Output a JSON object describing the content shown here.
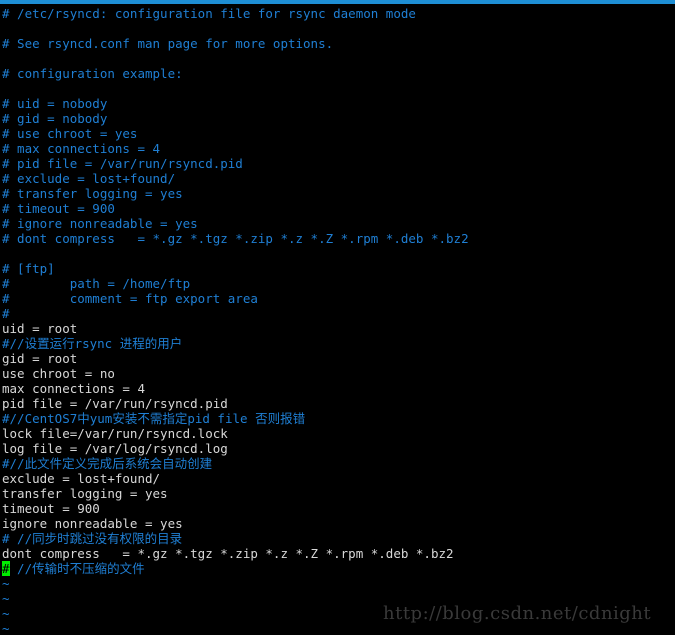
{
  "window": {
    "title": "vim /etc/rsyncd.conf",
    "top_bar_color": "#1e8fd5",
    "background_color": "#000000",
    "comment_color": "#1f7fd4",
    "text_color": "#d8d8d8",
    "cursor_color": "#00ee00"
  },
  "editor": {
    "lines": [
      {
        "id": 1,
        "kind": "comment",
        "text": "# /etc/rsyncd: configuration file for rsync daemon mode"
      },
      {
        "id": 2,
        "kind": "blank",
        "text": ""
      },
      {
        "id": 3,
        "kind": "comment",
        "text": "# See rsyncd.conf man page for more options."
      },
      {
        "id": 4,
        "kind": "blank",
        "text": ""
      },
      {
        "id": 5,
        "kind": "comment",
        "text": "# configuration example:"
      },
      {
        "id": 6,
        "kind": "blank",
        "text": ""
      },
      {
        "id": 7,
        "kind": "comment",
        "text": "# uid = nobody"
      },
      {
        "id": 8,
        "kind": "comment",
        "text": "# gid = nobody"
      },
      {
        "id": 9,
        "kind": "comment",
        "text": "# use chroot = yes"
      },
      {
        "id": 10,
        "kind": "comment",
        "text": "# max connections = 4"
      },
      {
        "id": 11,
        "kind": "comment",
        "text": "# pid file = /var/run/rsyncd.pid"
      },
      {
        "id": 12,
        "kind": "comment",
        "text": "# exclude = lost+found/"
      },
      {
        "id": 13,
        "kind": "comment",
        "text": "# transfer logging = yes"
      },
      {
        "id": 14,
        "kind": "comment",
        "text": "# timeout = 900"
      },
      {
        "id": 15,
        "kind": "comment",
        "text": "# ignore nonreadable = yes"
      },
      {
        "id": 16,
        "kind": "comment",
        "text": "# dont compress   = *.gz *.tgz *.zip *.z *.Z *.rpm *.deb *.bz2"
      },
      {
        "id": 17,
        "kind": "blank",
        "text": ""
      },
      {
        "id": 18,
        "kind": "comment",
        "text": "# [ftp]"
      },
      {
        "id": 19,
        "kind": "comment",
        "text": "#        path = /home/ftp"
      },
      {
        "id": 20,
        "kind": "comment",
        "text": "#        comment = ftp export area"
      },
      {
        "id": 21,
        "kind": "comment",
        "text": "#"
      },
      {
        "id": 22,
        "kind": "text",
        "text": "uid = root"
      },
      {
        "id": 23,
        "kind": "comment",
        "text": "#//设置运行rsync 进程的用户"
      },
      {
        "id": 24,
        "kind": "text",
        "text": "gid = root"
      },
      {
        "id": 25,
        "kind": "text",
        "text": "use chroot = no"
      },
      {
        "id": 26,
        "kind": "text",
        "text": "max connections = 4"
      },
      {
        "id": 27,
        "kind": "text",
        "text": "pid file = /var/run/rsyncd.pid"
      },
      {
        "id": 28,
        "kind": "comment",
        "text": "#//CentOS7中yum安装不需指定pid file 否则报错"
      },
      {
        "id": 29,
        "kind": "text",
        "text": "lock file=/var/run/rsyncd.lock"
      },
      {
        "id": 30,
        "kind": "text",
        "text": "log file = /var/log/rsyncd.log"
      },
      {
        "id": 31,
        "kind": "comment",
        "text": "#//此文件定义完成后系统会自动创建"
      },
      {
        "id": 32,
        "kind": "text",
        "text": "exclude = lost+found/"
      },
      {
        "id": 33,
        "kind": "text",
        "text": "transfer logging = yes"
      },
      {
        "id": 34,
        "kind": "text",
        "text": "timeout = 900"
      },
      {
        "id": 35,
        "kind": "text",
        "text": "ignore nonreadable = yes"
      },
      {
        "id": 36,
        "kind": "comment",
        "text": "# //同步时跳过没有权限的目录"
      },
      {
        "id": 37,
        "kind": "text",
        "text": "dont compress   = *.gz *.tgz *.zip *.z *.Z *.rpm *.deb *.bz2"
      },
      {
        "id": 38,
        "kind": "cursor-comment",
        "cursor_char": "#",
        "text": " //传输时不压缩的文件"
      },
      {
        "id": 39,
        "kind": "tilde",
        "text": "~"
      },
      {
        "id": 40,
        "kind": "tilde",
        "text": "~"
      },
      {
        "id": 41,
        "kind": "tilde",
        "text": "~"
      },
      {
        "id": 42,
        "kind": "tilde",
        "text": "~"
      }
    ]
  },
  "watermark": {
    "text": "http://blog.csdn.net/cdnight"
  }
}
